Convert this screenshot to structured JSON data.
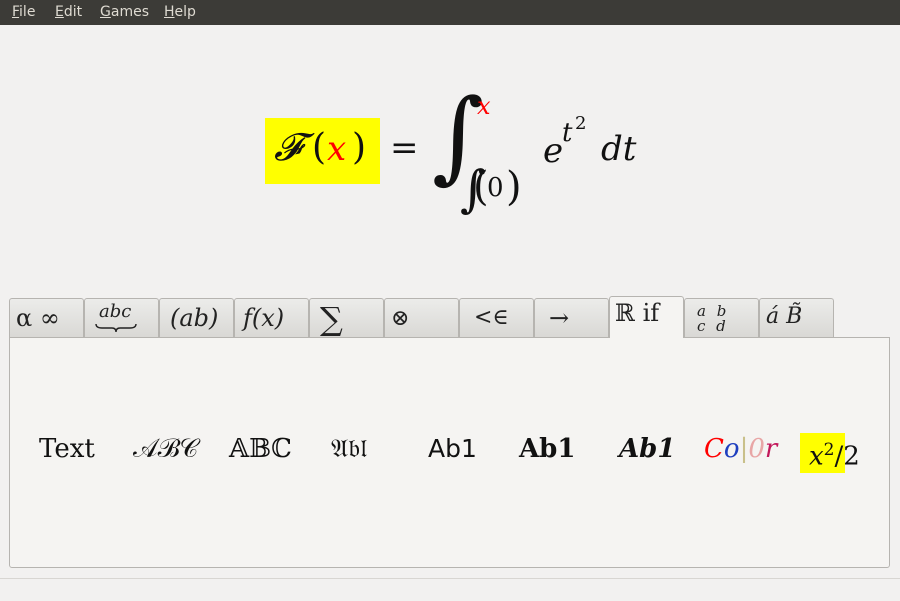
{
  "menu": {
    "file": {
      "mnemonic": "F",
      "rest": "ile"
    },
    "edit": {
      "mnemonic": "E",
      "rest": "dit"
    },
    "games": {
      "mnemonic": "G",
      "rest": "ames"
    },
    "help": {
      "mnemonic": "H",
      "rest": "elp"
    }
  },
  "formula": {
    "func": "𝓕",
    "lparen": "(",
    "var": "x",
    "rparen": ")",
    "equals": "=",
    "integral": "∫",
    "upper_limit": "x",
    "lower_integral": "∫",
    "lower_open": "(",
    "lower_value": "0",
    "lower_close": ")",
    "base": "e",
    "exp_var": "t",
    "exp_pow": "2",
    "differential": "dt",
    "highlight_color": "#ffff00",
    "var_color": "#ff0000"
  },
  "tabs": [
    {
      "label": "α ∞"
    },
    {
      "label": "abc"
    },
    {
      "label": "(ab)"
    },
    {
      "label": "f(x)"
    },
    {
      "label": "∑"
    },
    {
      "label": "⊗"
    },
    {
      "label": "<∈"
    },
    {
      "label": "→"
    },
    {
      "label": "ℝ if"
    },
    {
      "label": "a b c d"
    },
    {
      "label": "á B̃"
    }
  ],
  "active_tab": "ℝ if",
  "symbols": {
    "text": "Text",
    "calligraphic": "𝒜ℬ𝒞",
    "blackboard": "𝔸𝔹ℂ",
    "fraktur": "𝔄𝔟𝔩",
    "sans": "Ab1",
    "bold": "Ab1",
    "bold_italic": "Ab1",
    "color": {
      "c": "C",
      "o": "o",
      "bar": "|",
      "zero": "0",
      "r": "r"
    },
    "power": {
      "base": "x",
      "exp": "2",
      "slash": "/2"
    }
  },
  "colors": {
    "menubar": "#3c3b37",
    "highlight": "#ffff00",
    "red": "#ff0000",
    "blue": "#1f3fbf",
    "pink": "#e8a6a6",
    "magenta": "#c2185b"
  }
}
